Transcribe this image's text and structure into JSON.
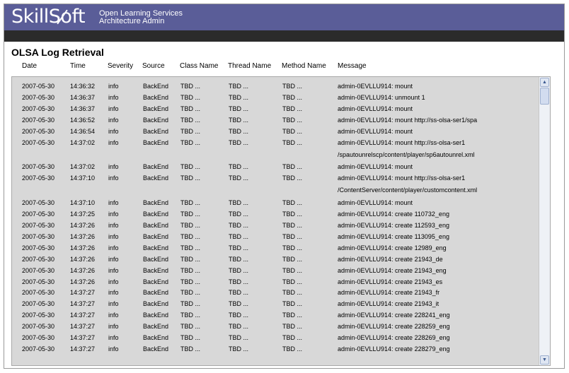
{
  "app": {
    "logo_pre": "SkillS",
    "logo_o": "o",
    "logo_post": "ft",
    "tagline1": "Open Learning Services",
    "tagline2": "Architecture Admin"
  },
  "page": {
    "title": "OLSA Log Retrieval"
  },
  "columns": [
    "Date",
    "Time",
    "Severity",
    "Source",
    "Class Name",
    "Thread Name",
    "Method Name",
    "Message"
  ],
  "rows": [
    {
      "date": "2007-05-30",
      "time": "14:36:32",
      "severity": "info",
      "source": "BackEnd",
      "class": "TBD ...",
      "thread": "TBD ...",
      "method": "TBD ...",
      "message": "admin-0EVLLU914: mount",
      "cont": ""
    },
    {
      "date": "2007-05-30",
      "time": "14:36:37",
      "severity": "info",
      "source": "BackEnd",
      "class": "TBD ...",
      "thread": "TBD ...",
      "method": "TBD ...",
      "message": "admin-0EVLLU914: unmount 1",
      "cont": ""
    },
    {
      "date": "2007-05-30",
      "time": "14:36:37",
      "severity": "info",
      "source": "BackEnd",
      "class": "TBD ...",
      "thread": "TBD ...",
      "method": "TBD ...",
      "message": "admin-0EVLLU914: mount",
      "cont": ""
    },
    {
      "date": "2007-05-30",
      "time": "14:36:52",
      "severity": "info",
      "source": "BackEnd",
      "class": "TBD ...",
      "thread": "TBD ...",
      "method": "TBD ...",
      "message": "admin-0EVLLU914: mount http://ss-olsa-ser1/spa",
      "cont": ""
    },
    {
      "date": "2007-05-30",
      "time": "14:36:54",
      "severity": "info",
      "source": "BackEnd",
      "class": "TBD ...",
      "thread": "TBD ...",
      "method": "TBD ...",
      "message": "admin-0EVLLU914: mount",
      "cont": ""
    },
    {
      "date": "2007-05-30",
      "time": "14:37:02",
      "severity": "info",
      "source": "BackEnd",
      "class": "TBD ...",
      "thread": "TBD ...",
      "method": "TBD ...",
      "message": "admin-0EVLLU914: mount http://ss-olsa-ser1",
      "cont": "/spautounrelscp/content/player/sp6autounrel.xml"
    },
    {
      "date": "2007-05-30",
      "time": "14:37:02",
      "severity": "info",
      "source": "BackEnd",
      "class": "TBD ...",
      "thread": "TBD ...",
      "method": "TBD ...",
      "message": "admin-0EVLLU914: mount",
      "cont": ""
    },
    {
      "date": "2007-05-30",
      "time": "14:37:10",
      "severity": "info",
      "source": "BackEnd",
      "class": "TBD ...",
      "thread": "TBD ...",
      "method": "TBD ...",
      "message": "admin-0EVLLU914: mount http://ss-olsa-ser1",
      "cont": "/ContentServer/content/player/customcontent.xml"
    },
    {
      "date": "2007-05-30",
      "time": "14:37:10",
      "severity": "info",
      "source": "BackEnd",
      "class": "TBD ...",
      "thread": "TBD ...",
      "method": "TBD ...",
      "message": "admin-0EVLLU914: mount",
      "cont": ""
    },
    {
      "date": "2007-05-30",
      "time": "14:37:25",
      "severity": "info",
      "source": "BackEnd",
      "class": "TBD ...",
      "thread": "TBD ...",
      "method": "TBD ...",
      "message": "admin-0EVLLU914: create 110732_eng",
      "cont": ""
    },
    {
      "date": "2007-05-30",
      "time": "14:37:26",
      "severity": "info",
      "source": "BackEnd",
      "class": "TBD ...",
      "thread": "TBD ...",
      "method": "TBD ...",
      "message": "admin-0EVLLU914: create 112593_eng",
      "cont": ""
    },
    {
      "date": "2007-05-30",
      "time": "14:37:26",
      "severity": "info",
      "source": "BackEnd",
      "class": "TBD ...",
      "thread": "TBD ...",
      "method": "TBD ...",
      "message": "admin-0EVLLU914: create 113095_eng",
      "cont": ""
    },
    {
      "date": "2007-05-30",
      "time": "14:37:26",
      "severity": "info",
      "source": "BackEnd",
      "class": "TBD ...",
      "thread": "TBD ...",
      "method": "TBD ...",
      "message": "admin-0EVLLU914: create 12989_eng",
      "cont": ""
    },
    {
      "date": "2007-05-30",
      "time": "14:37:26",
      "severity": "info",
      "source": "BackEnd",
      "class": "TBD ...",
      "thread": "TBD ...",
      "method": "TBD ...",
      "message": "admin-0EVLLU914: create 21943_de",
      "cont": ""
    },
    {
      "date": "2007-05-30",
      "time": "14:37:26",
      "severity": "info",
      "source": "BackEnd",
      "class": "TBD ...",
      "thread": "TBD ...",
      "method": "TBD ...",
      "message": "admin-0EVLLU914: create 21943_eng",
      "cont": ""
    },
    {
      "date": "2007-05-30",
      "time": "14:37:26",
      "severity": "info",
      "source": "BackEnd",
      "class": "TBD ...",
      "thread": "TBD ...",
      "method": "TBD ...",
      "message": "admin-0EVLLU914: create 21943_es",
      "cont": ""
    },
    {
      "date": "2007-05-30",
      "time": "14:37:27",
      "severity": "info",
      "source": "BackEnd",
      "class": "TBD ...",
      "thread": "TBD ...",
      "method": "TBD ...",
      "message": "admin-0EVLLU914: create 21943_fr",
      "cont": ""
    },
    {
      "date": "2007-05-30",
      "time": "14:37:27",
      "severity": "info",
      "source": "BackEnd",
      "class": "TBD ...",
      "thread": "TBD ...",
      "method": "TBD ...",
      "message": "admin-0EVLLU914: create 21943_it",
      "cont": ""
    },
    {
      "date": "2007-05-30",
      "time": "14:37:27",
      "severity": "info",
      "source": "BackEnd",
      "class": "TBD ...",
      "thread": "TBD ...",
      "method": "TBD ...",
      "message": "admin-0EVLLU914: create 228241_eng",
      "cont": ""
    },
    {
      "date": "2007-05-30",
      "time": "14:37:27",
      "severity": "info",
      "source": "BackEnd",
      "class": "TBD ...",
      "thread": "TBD ...",
      "method": "TBD ...",
      "message": "admin-0EVLLU914: create 228259_eng",
      "cont": ""
    },
    {
      "date": "2007-05-30",
      "time": "14:37:27",
      "severity": "info",
      "source": "BackEnd",
      "class": "TBD ...",
      "thread": "TBD ...",
      "method": "TBD ...",
      "message": "admin-0EVLLU914: create 228269_eng",
      "cont": ""
    },
    {
      "date": "2007-05-30",
      "time": "14:37:27",
      "severity": "info",
      "source": "BackEnd",
      "class": "TBD ...",
      "thread": "TBD ...",
      "method": "TBD ...",
      "message": "admin-0EVLLU914: create 228279_eng",
      "cont": ""
    }
  ],
  "scrollbar": {
    "up_icon": "scroll-up-arrow-icon",
    "down_icon": "scroll-down-arrow-icon"
  },
  "colors": {
    "header_bg": "#5a5d98",
    "dark_bar": "#2b2b2b",
    "panel_bg": "#d8d8d8"
  }
}
